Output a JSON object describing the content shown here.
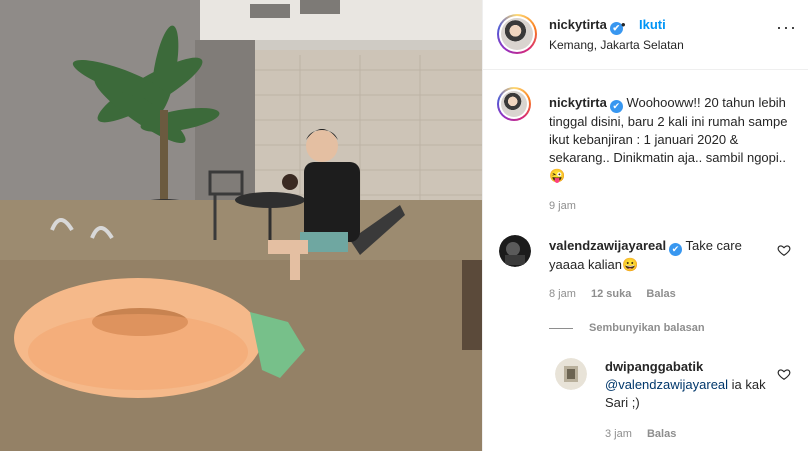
{
  "post": {
    "username": "nickytirta",
    "verified_mark": "✔",
    "separator": "•",
    "follow_label": "Ikuti",
    "location": "Kemang, Jakarta Selatan",
    "more_icon": "more-options-icon"
  },
  "caption": {
    "username": "nickytirta",
    "text": "Woohooww!! 20 tahun lebih tinggal disini, baru 2 kali ini rumah sampe ikut kebanjiran : 1 januari 2020 & sekarang.. Dinikmatin aja.. sambil ngopi.. 😜",
    "time": "9 jam"
  },
  "comments": [
    {
      "username": "valendzawijayareal",
      "text": "Take care yaaaa kalian😀",
      "time": "8 jam",
      "likes": "12 suka",
      "reply_label": "Balas"
    }
  ],
  "hide_replies_label": "Sembunyikan balasan",
  "replies": [
    {
      "username": "dwipanggabatik",
      "mention": "@valendzawijayareal",
      "text": " ia kak Sari ;)",
      "time": "3 jam",
      "reply_label": "Balas"
    }
  ],
  "colors": {
    "link_blue": "#0095f6",
    "verified_blue": "#3897f0",
    "secondary_text": "#8e8e8e",
    "primary_text": "#262626",
    "mention": "#00376b"
  }
}
